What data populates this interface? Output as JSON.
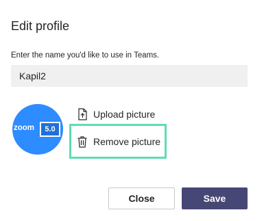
{
  "dialog": {
    "title": "Edit profile",
    "name_label": "Enter the name you'd like to use in Teams.",
    "name_value": "Kapil2"
  },
  "avatar": {
    "brand_text": "zoom",
    "version_text": "5.0",
    "colors": {
      "background": "#2d8cff",
      "badge": "#1f6fd8"
    }
  },
  "actions": {
    "upload_label": "Upload picture",
    "upload_icon": "upload-file-icon",
    "remove_label": "Remove picture",
    "remove_icon": "trash-icon",
    "highlight_color": "#5fdcb0"
  },
  "footer": {
    "close_label": "Close",
    "save_label": "Save",
    "save_color": "#464775"
  }
}
